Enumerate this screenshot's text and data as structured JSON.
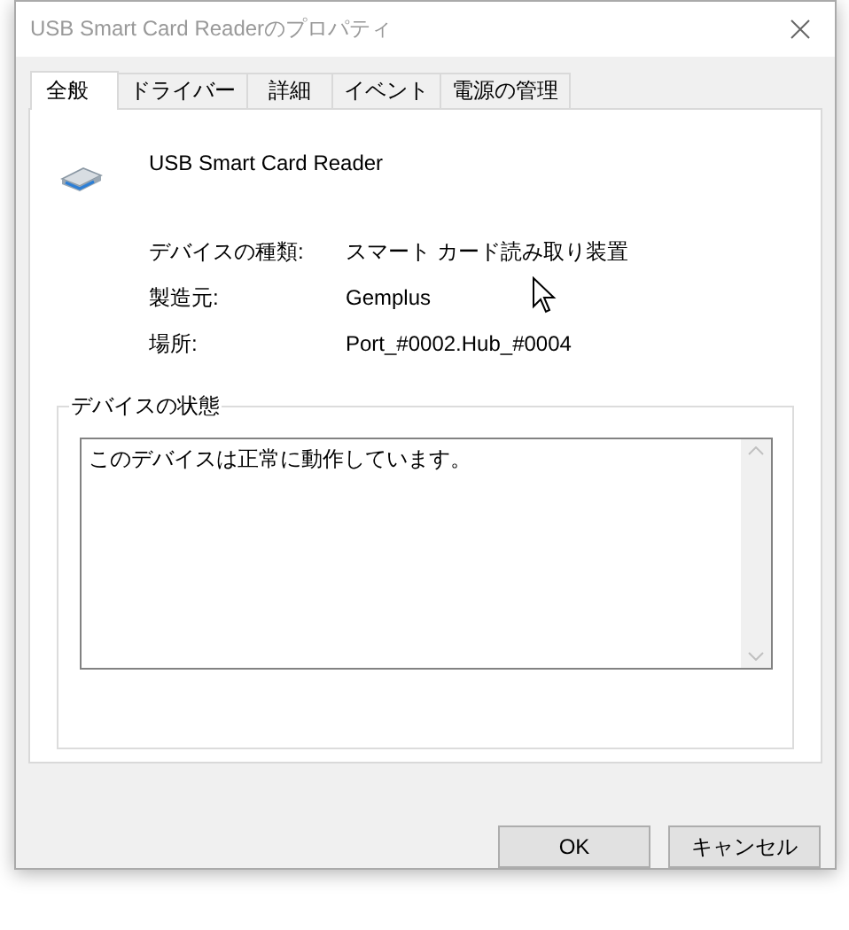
{
  "window": {
    "title": "USB Smart Card Readerのプロパティ"
  },
  "tabs": [
    {
      "label": "全般",
      "selected": true
    },
    {
      "label": "ドライバー",
      "selected": false
    },
    {
      "label": "詳細",
      "selected": false
    },
    {
      "label": "イベント",
      "selected": false
    },
    {
      "label": "電源の管理",
      "selected": false
    }
  ],
  "device": {
    "name": "USB Smart Card Reader"
  },
  "properties": [
    {
      "label": "デバイスの種類:",
      "value": "スマート カード読み取り装置"
    },
    {
      "label": "製造元:",
      "value": "Gemplus"
    },
    {
      "label": "場所:",
      "value": "Port_#0002.Hub_#0004"
    }
  ],
  "device_status": {
    "title": "デバイスの状態",
    "text": "このデバイスは正常に動作しています。"
  },
  "buttons": [
    "OK",
    "キャンセル"
  ]
}
